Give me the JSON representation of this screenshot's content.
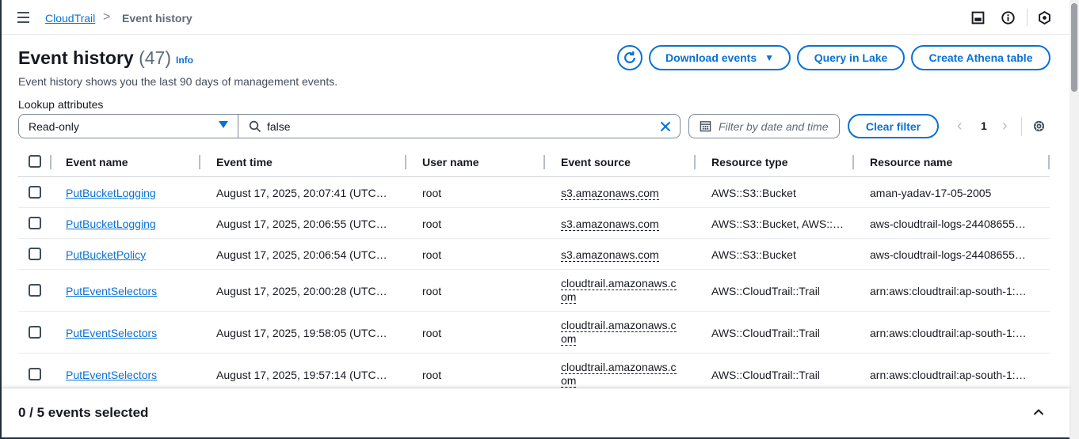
{
  "breadcrumb": {
    "parent": "CloudTrail",
    "separator": ">",
    "current": "Event history"
  },
  "header": {
    "title": "Event history",
    "count": "(47)",
    "info": "Info",
    "description": "Event history shows you the last 90 days of management events."
  },
  "actions": {
    "download_label": "Download events",
    "lake_label": "Query in Lake",
    "athena_label": "Create Athena table"
  },
  "filters": {
    "lookup_label": "Lookup attributes",
    "attribute_value": "Read-only",
    "search_value": "false",
    "date_placeholder": "Filter by date and time",
    "clear_label": "Clear filter"
  },
  "pagination": {
    "page": "1"
  },
  "table": {
    "columns": [
      "Event name",
      "Event time",
      "User name",
      "Event source",
      "Resource type",
      "Resource name"
    ],
    "rows": [
      {
        "event_name": "PutBucketLogging",
        "event_time": "August 17, 2025, 20:07:41 (UTC…",
        "user": "root",
        "source": "s3.amazonaws.com",
        "resource_type": "AWS::S3::Bucket",
        "resource_name": "aman-yadav-17-05-2005"
      },
      {
        "event_name": "PutBucketLogging",
        "event_time": "August 17, 2025, 20:06:55 (UTC…",
        "user": "root",
        "source": "s3.amazonaws.com",
        "resource_type": "AWS::S3::Bucket, AWS::…",
        "resource_name": "aws-cloudtrail-logs-24408655…"
      },
      {
        "event_name": "PutBucketPolicy",
        "event_time": "August 17, 2025, 20:06:54 (UTC…",
        "user": "root",
        "source": "s3.amazonaws.com",
        "resource_type": "AWS::S3::Bucket",
        "resource_name": "aws-cloudtrail-logs-24408655…"
      },
      {
        "event_name": "PutEventSelectors",
        "event_time": "August 17, 2025, 20:00:28 (UTC…",
        "user": "root",
        "source": "cloudtrail.amazonaws.com",
        "resource_type": "AWS::CloudTrail::Trail",
        "resource_name": "arn:aws:cloudtrail:ap-south-1:…"
      },
      {
        "event_name": "PutEventSelectors",
        "event_time": "August 17, 2025, 19:58:05 (UTC…",
        "user": "root",
        "source": "cloudtrail.amazonaws.com",
        "resource_type": "AWS::CloudTrail::Trail",
        "resource_name": "arn:aws:cloudtrail:ap-south-1:…"
      },
      {
        "event_name": "PutEventSelectors",
        "event_time": "August 17, 2025, 19:57:14 (UTC…",
        "user": "root",
        "source": "cloudtrail.amazonaws.com",
        "resource_type": "AWS::CloudTrail::Trail",
        "resource_name": "arn:aws:cloudtrail:ap-south-1:…"
      }
    ]
  },
  "footer": {
    "selected_text": "0 / 5 events selected"
  },
  "icons": {
    "menu": "hamburger-menu-icon",
    "panel": "side-panel-icon",
    "info": "info-circle-icon",
    "notifications": "hexagon-badge-icon",
    "refresh": "refresh-icon",
    "search": "search-icon",
    "clear": "close-icon",
    "calendar": "calendar-icon",
    "settings": "gear-icon",
    "expand": "chevron-up-icon"
  },
  "colors": {
    "accent": "#0972d3",
    "text": "#16191f",
    "muted": "#5f6b7a"
  }
}
